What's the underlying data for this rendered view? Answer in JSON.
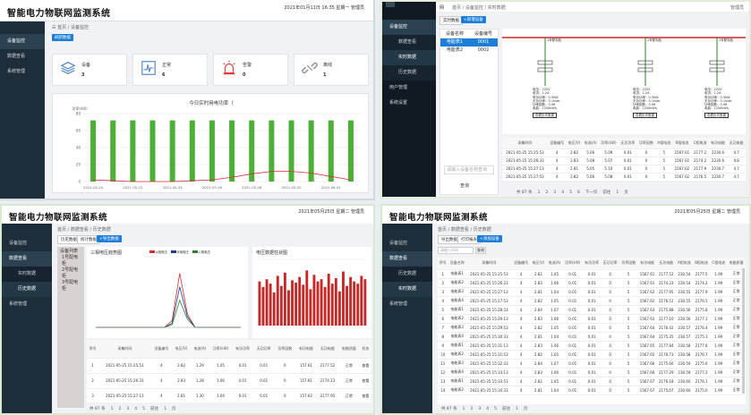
{
  "p1": {
    "title": "智能电力物联网监测系统",
    "user": "2021年01月11日 16:35 星期一 管理员",
    "menu": [
      "设备监控",
      "数据查看",
      "系统管理"
    ],
    "crumb": [
      "首页",
      "设备监控"
    ],
    "btn": "刷新数据",
    "cards": [
      {
        "label": "设备",
        "value": "3"
      },
      {
        "label": "正常",
        "value": "6"
      },
      {
        "label": "告警",
        "value": "0"
      },
      {
        "label": "离线",
        "value": "1"
      }
    ],
    "chart_title": "今日实时用电功率（",
    "ylabel": "功率(kW)"
  },
  "p2": {
    "brand": "网",
    "user": "管理员",
    "menu": [
      "设备监控",
      "数据查看",
      "实时数据",
      "历史数据",
      "用户管理",
      "系统设置"
    ],
    "crumb": [
      "首页",
      "设备监控",
      "实时数据"
    ],
    "btn": "+新增设备",
    "tabs": [
      "设备名称",
      "设备编号"
    ],
    "list": [
      {
        "name": "电能表1",
        "code": "0001"
      },
      {
        "name": "电能表2",
        "code": "0002"
      }
    ],
    "list_foot": "请输入设备名称查询",
    "query": "查询",
    "branches": [
      "1号配电柜",
      "2号配电柜",
      "3号配电柜"
    ],
    "node_lines": [
      "电压：220V",
      "电流：1.2A",
      "有功功率：0.3kW",
      "无功功率：0.1kVar",
      "功率因数：0.98",
      "电能：1250kWh"
    ],
    "node_btn": "查看历史数据",
    "headers": [
      "采集时间",
      "设备编号",
      "电压(V)",
      "电流(A)",
      "功率(kW)",
      "无功功率",
      "功率因数",
      "A相电流",
      "B相电流",
      "C相电流",
      "有功电能",
      "无功电能"
    ],
    "rows": [
      [
        "2021-05-25 15:25:53",
        "4",
        "2.82",
        "5.06",
        "5.09",
        "0.01",
        "0",
        "5",
        "1567.61",
        "2177.2",
        "2230.6",
        "4.7"
      ],
      [
        "2021-05-25 15:26:33",
        "4",
        "2.83",
        "5.08",
        "5.07",
        "0.01",
        "0",
        "5",
        "1567.61",
        "2174.2",
        "2230.6",
        "4.8"
      ],
      [
        "2021-05-25 15:27:13",
        "4",
        "2.81",
        "5.05",
        "5.10",
        "0.01",
        "0",
        "5",
        "1567.62",
        "2177.9",
        "2230.7",
        "4.7"
      ],
      [
        "2021-05-25 15:27:53",
        "4",
        "2.82",
        "5.06",
        "5.08",
        "0.01",
        "0",
        "5",
        "1567.62",
        "2176.5",
        "2230.7",
        "4.7"
      ]
    ],
    "pager": [
      "共 87 条",
      "1",
      "2",
      "3",
      "4",
      "5",
      "6",
      "下一页",
      "前往",
      "1",
      "页"
    ]
  },
  "p3": {
    "title": "智能电力物联网监测系统",
    "user": "2021年05月25日 星期二 管理员",
    "menu": [
      "设备监控",
      "数据查看",
      "实时数据",
      "历史数据",
      "系统管理"
    ],
    "crumb": [
      "首页",
      "数据查看",
      "历史数据"
    ],
    "btn": "+导出数据",
    "tabs": [
      "历史数据",
      "统计数据"
    ],
    "tree": [
      "设备列表",
      "1号配电柜",
      "2号配电柜",
      "3号配电柜"
    ],
    "chart1_title": "三相电压趋势图",
    "legend": [
      "A相电压",
      "B相电压",
      "C相电压"
    ],
    "chart2_title": "电压数据柱状图",
    "headers": [
      "序号",
      "采集时间",
      "设备编号",
      "电压(V)",
      "电流(A)",
      "功率(kW)",
      "有功功率",
      "无功功率",
      "功率因数",
      "有功电能",
      "无功电能",
      "电能质量",
      "状态"
    ],
    "rows": [
      [
        "1",
        "2021-05-25 15:25:53",
        "4",
        "2.82",
        "1.29",
        "1.05",
        "0.01",
        "0.01",
        "0",
        "157.61",
        "2177.52",
        "正常",
        "查看"
      ],
      [
        "2",
        "2021-05-25 15:26:33",
        "4",
        "2.83",
        "1.28",
        "1.06",
        "0.01",
        "0.01",
        "0",
        "157.61",
        "2174.23",
        "正常",
        "查看"
      ],
      [
        "3",
        "2021-05-25 15:27:13",
        "4",
        "2.81",
        "1.30",
        "1.04",
        "0.01",
        "0.01",
        "0",
        "157.62",
        "2177.95",
        "正常",
        "查看"
      ]
    ],
    "pager": [
      "共 87 条",
      "1",
      "2",
      "3",
      "4",
      "5",
      "前往",
      "1",
      "页"
    ]
  },
  "p4": {
    "title": "智能电力物联网监测系统",
    "user": "2021年05月25日 星期二 管理员",
    "menu": [
      "设备监控",
      "数据查看",
      "历史数据",
      "实时数据",
      "系统管理"
    ],
    "crumb": [
      "首页",
      "数据查看",
      "历史数据"
    ],
    "btns": [
      "导出数据",
      "打印报表",
      "+添加设备"
    ],
    "search_placeholder": "请输入时间",
    "query": "查询",
    "headers": [
      "序号",
      "设备名称",
      "采集时间",
      "设备编号",
      "电压(V)",
      "电流(A)",
      "功率(kW)",
      "有功功率",
      "无功功率",
      "功率因数",
      "有功电能",
      "无功电能",
      "A相电流",
      "B相电流",
      "C相电流",
      "电能质量"
    ],
    "rows": [
      [
        "1",
        "电能表1",
        "2021-05-25 15:25:53",
        "4",
        "2.82",
        "1.05",
        "0.01",
        "0.01",
        "0",
        "5",
        "1567.61",
        "2177.52",
        "230.54",
        "2177.5",
        "1.99",
        "正常"
      ],
      [
        "2",
        "电能表2",
        "2021-05-25 15:26:33",
        "4",
        "2.83",
        "1.06",
        "0.01",
        "0.01",
        "0",
        "5",
        "1567.61",
        "2174.23",
        "230.54",
        "2174.2",
        "1.99",
        "正常"
      ],
      [
        "3",
        "电能表3",
        "2021-05-25 15:27:13",
        "4",
        "2.81",
        "1.04",
        "0.01",
        "0.01",
        "0",
        "5",
        "1567.62",
        "2177.95",
        "230.55",
        "2177.9",
        "1.99",
        "正常"
      ],
      [
        "4",
        "电能表4",
        "2021-05-25 15:27:53",
        "4",
        "2.82",
        "1.05",
        "0.01",
        "0.01",
        "0",
        "5",
        "1567.62",
        "2176.51",
        "230.55",
        "2176.5",
        "1.99",
        "正常"
      ],
      [
        "5",
        "电能表1",
        "2021-05-25 15:28:33",
        "4",
        "2.84",
        "1.07",
        "0.01",
        "0.01",
        "0",
        "5",
        "1567.63",
        "2175.88",
        "230.56",
        "2175.8",
        "1.99",
        "正常"
      ],
      [
        "6",
        "电能表2",
        "2021-05-25 15:29:13",
        "4",
        "2.83",
        "1.06",
        "0.01",
        "0.01",
        "0",
        "5",
        "1567.63",
        "2177.10",
        "230.56",
        "2177.1",
        "1.99",
        "正常"
      ],
      [
        "7",
        "电能表3",
        "2021-05-25 15:29:53",
        "4",
        "2.82",
        "1.05",
        "0.01",
        "0.01",
        "0",
        "5",
        "1567.64",
        "2176.42",
        "230.57",
        "2176.4",
        "1.99",
        "正常"
      ],
      [
        "8",
        "电能表4",
        "2021-05-25 15:30:33",
        "4",
        "2.81",
        "1.04",
        "0.01",
        "0.01",
        "0",
        "5",
        "1567.64",
        "2175.35",
        "230.57",
        "2175.3",
        "1.99",
        "正常"
      ],
      [
        "9",
        "电能表1",
        "2021-05-25 15:31:13",
        "4",
        "2.83",
        "1.06",
        "0.01",
        "0.01",
        "0",
        "5",
        "1567.65",
        "2177.84",
        "230.58",
        "2177.8",
        "1.99",
        "正常"
      ],
      [
        "10",
        "电能表2",
        "2021-05-25 15:31:53",
        "4",
        "2.82",
        "1.05",
        "0.01",
        "0.01",
        "0",
        "5",
        "1567.65",
        "2176.73",
        "230.58",
        "2176.7",
        "1.99",
        "正常"
      ],
      [
        "11",
        "电能表3",
        "2021-05-25 15:32:33",
        "4",
        "2.84",
        "1.07",
        "0.01",
        "0.01",
        "0",
        "5",
        "1567.66",
        "2175.66",
        "230.59",
        "2175.6",
        "1.99",
        "正常"
      ],
      [
        "12",
        "电能表4",
        "2021-05-25 15:33:13",
        "4",
        "2.83",
        "1.06",
        "0.01",
        "0.01",
        "0",
        "5",
        "1567.66",
        "2177.29",
        "230.59",
        "2177.2",
        "1.99",
        "正常"
      ],
      [
        "13",
        "电能表1",
        "2021-05-25 15:33:53",
        "4",
        "2.82",
        "1.05",
        "0.01",
        "0.01",
        "0",
        "5",
        "1567.67",
        "2176.18",
        "230.60",
        "2176.1",
        "1.99",
        "正常"
      ],
      [
        "14",
        "电能表2",
        "2021-05-25 15:34:33",
        "4",
        "2.81",
        "1.04",
        "0.01",
        "0.01",
        "0",
        "5",
        "1567.67",
        "2175.07",
        "230.60",
        "2175.0",
        "1.99",
        "正常"
      ]
    ],
    "pager": [
      "共 87 条",
      "1",
      "2",
      "3",
      "4",
      "5",
      "前往",
      "1",
      "页"
    ]
  },
  "chart_data": [
    {
      "type": "bar",
      "title": "今日实时用电功率（",
      "ylabel": "功率(kW)",
      "categories": [
        "2021-05-20",
        "2021-05-21",
        "2021-05-22",
        "2021-05-23",
        "2021-05-24",
        "2021-05-25",
        "2021-05-26",
        "2021-05-27",
        "2021-05-28",
        "2021-05-29",
        "2021-05-30",
        "2021-05-31",
        "2021-06-01",
        "2021-06-02"
      ],
      "values": [
        72,
        72,
        72,
        72,
        72,
        72,
        72,
        72,
        72,
        72,
        72,
        72,
        72,
        72
      ],
      "line": [
        2,
        1,
        0,
        0,
        0,
        1,
        2,
        5,
        9,
        12,
        12,
        10,
        6,
        2
      ],
      "ylim": [
        0,
        80
      ],
      "yticks": [
        0,
        20,
        40,
        60,
        80
      ],
      "xticklabels": [
        "2021-05-20",
        "2021-05-22",
        "2021-05-24",
        "2021-05-26",
        "2021-05-28",
        "2021-05-30",
        "2021-06-01"
      ],
      "colors": {
        "bar": "#4caf36",
        "line": "#d32f2f"
      }
    },
    {
      "type": "line",
      "title": "三相电压趋势图",
      "series": [
        {
          "name": "A相电压",
          "values": [
            0,
            0,
            0,
            0,
            0,
            0,
            0,
            0,
            0,
            0,
            5,
            40,
            10,
            0,
            0,
            0,
            0,
            0,
            0,
            0
          ]
        },
        {
          "name": "B相电压",
          "values": [
            0,
            0,
            0,
            0,
            0,
            0,
            0,
            0,
            0,
            0,
            3,
            30,
            8,
            0,
            0,
            0,
            0,
            0,
            0,
            0
          ]
        },
        {
          "name": "C相电压",
          "values": [
            0,
            0,
            0,
            0,
            0,
            0,
            0,
            0,
            0,
            0,
            2,
            20,
            6,
            0,
            0,
            0,
            0,
            0,
            0,
            0
          ]
        }
      ],
      "ylim": [
        0,
        45
      ],
      "colors": [
        "#d32f2f",
        "#1c3e8c",
        "#2e7d32"
      ]
    },
    {
      "type": "bar",
      "title": "电压数据柱状图",
      "values": [
        40,
        35,
        42,
        38,
        30,
        45,
        36,
        48,
        32,
        41,
        39,
        44,
        37,
        50,
        33,
        46,
        40,
        42,
        35,
        47,
        38,
        43,
        31,
        49,
        36,
        44,
        40,
        38,
        45,
        42
      ],
      "ylim": [
        0,
        60
      ],
      "colors": {
        "bar": "#c62828"
      }
    }
  ]
}
